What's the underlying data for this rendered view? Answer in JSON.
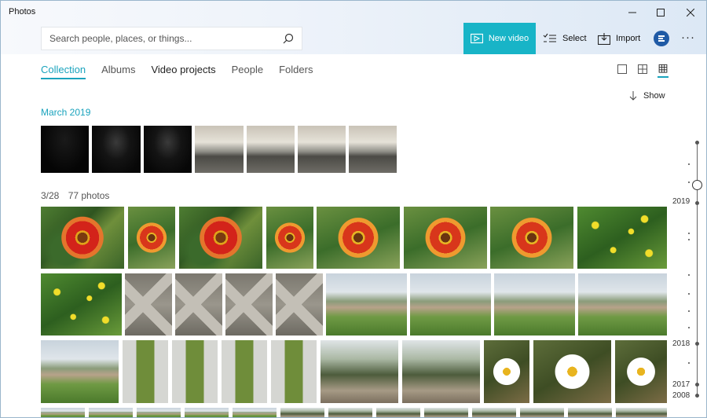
{
  "window": {
    "title": "Photos",
    "controls": {
      "minimize": "—",
      "maximize": "☐",
      "close": "✕"
    }
  },
  "search": {
    "placeholder": "Search people, places, or things..."
  },
  "toolbar": {
    "new_video_label": "New video",
    "select_label": "Select",
    "import_label": "Import",
    "more_label": "···"
  },
  "tabs": [
    {
      "label": "Collection",
      "active": true
    },
    {
      "label": "Albums"
    },
    {
      "label": "Video projects"
    },
    {
      "label": "People"
    },
    {
      "label": "Folders"
    }
  ],
  "view": {
    "show_label": "Show"
  },
  "sections": [
    {
      "date": "March 2019"
    },
    {
      "date": "3/28",
      "count": "77 photos"
    }
  ],
  "timeline": {
    "years": [
      "2019",
      "2018",
      "2017",
      "2008"
    ]
  },
  "colors": {
    "accent": "#1aa3bd",
    "new_video_bg": "#18b4c7"
  }
}
